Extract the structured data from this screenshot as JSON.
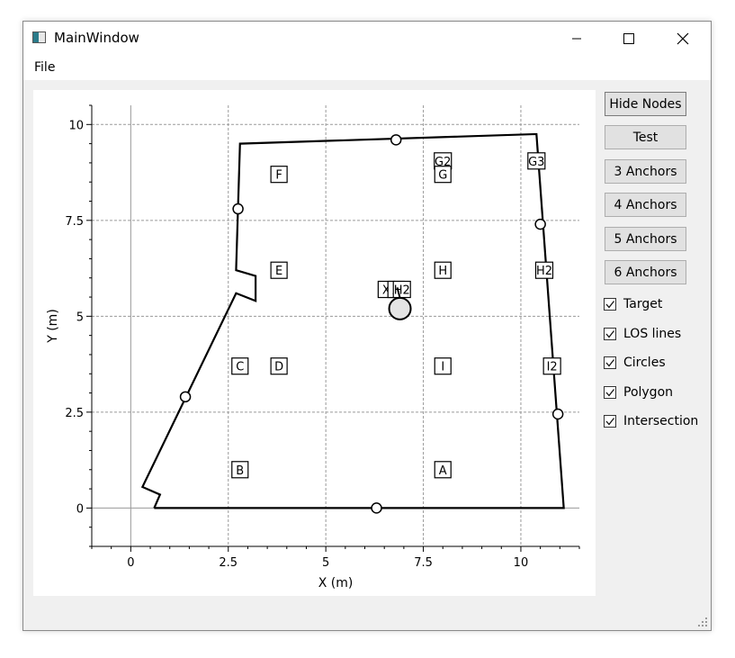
{
  "window": {
    "title": "MainWindow",
    "icon": "app-window-icon"
  },
  "menubar": {
    "items": [
      "File"
    ]
  },
  "buttons": [
    "Hide Nodes",
    "Test",
    "3 Anchors",
    "4 Anchors",
    "5 Anchors",
    "6 Anchors"
  ],
  "checkboxes": [
    {
      "label": "Target",
      "checked": true
    },
    {
      "label": "LOS lines",
      "checked": true
    },
    {
      "label": "Circles",
      "checked": true
    },
    {
      "label": "Polygon",
      "checked": true
    },
    {
      "label": "Intersection",
      "checked": true
    }
  ],
  "chart_data": {
    "type": "scatter",
    "xlabel": "X (m)",
    "ylabel": "Y (m)",
    "xlim": [
      -1,
      11.5
    ],
    "ylim": [
      -1,
      10.5
    ],
    "x_ticks": [
      0,
      2.5,
      5,
      7.5,
      10
    ],
    "x_tick_labels": [
      "0",
      "2.5",
      "5",
      "7.5",
      "10"
    ],
    "y_ticks": [
      0,
      2.5,
      5,
      7.5,
      10
    ],
    "y_tick_labels": [
      "0",
      "2.5",
      "5",
      "7.5",
      "10"
    ],
    "grid": true,
    "polygon": [
      [
        0.6,
        0
      ],
      [
        11.1,
        0
      ],
      [
        10.4,
        9.75
      ],
      [
        2.8,
        9.5
      ],
      [
        2.7,
        6.2
      ],
      [
        3.2,
        6.05
      ],
      [
        3.2,
        5.4
      ],
      [
        2.7,
        5.6
      ],
      [
        0.3,
        0.55
      ],
      [
        0.75,
        0.35
      ],
      [
        0.6,
        0
      ]
    ],
    "anchors": [
      [
        2.75,
        7.8
      ],
      [
        6.8,
        9.6
      ],
      [
        10.5,
        7.4
      ],
      [
        10.95,
        2.45
      ],
      [
        6.3,
        0
      ],
      [
        1.4,
        2.9
      ]
    ],
    "nodes": [
      {
        "label": "F",
        "x": 3.8,
        "y": 8.7
      },
      {
        "label": "E",
        "x": 3.8,
        "y": 6.2
      },
      {
        "label": "C",
        "x": 2.8,
        "y": 3.7
      },
      {
        "label": "D",
        "x": 3.8,
        "y": 3.7
      },
      {
        "label": "B",
        "x": 2.8,
        "y": 1.0
      },
      {
        "label": "G2",
        "x": 8.0,
        "y": 9.05
      },
      {
        "label": "G",
        "x": 8.0,
        "y": 8.7
      },
      {
        "label": "G3",
        "x": 10.4,
        "y": 9.05
      },
      {
        "label": "H",
        "x": 8.0,
        "y": 6.2
      },
      {
        "label": "H2",
        "x": 10.6,
        "y": 6.2
      },
      {
        "label": "I",
        "x": 8.0,
        "y": 3.7
      },
      {
        "label": "I2",
        "x": 10.8,
        "y": 3.7
      },
      {
        "label": "A",
        "x": 8.0,
        "y": 1.0
      },
      {
        "label": "X",
        "x": 6.55,
        "y": 5.7
      },
      {
        "label": "X",
        "x": 6.8,
        "y": 5.7
      },
      {
        "label": "H2",
        "x": 6.95,
        "y": 5.7
      }
    ],
    "target": {
      "x": 6.9,
      "y": 5.2
    }
  }
}
